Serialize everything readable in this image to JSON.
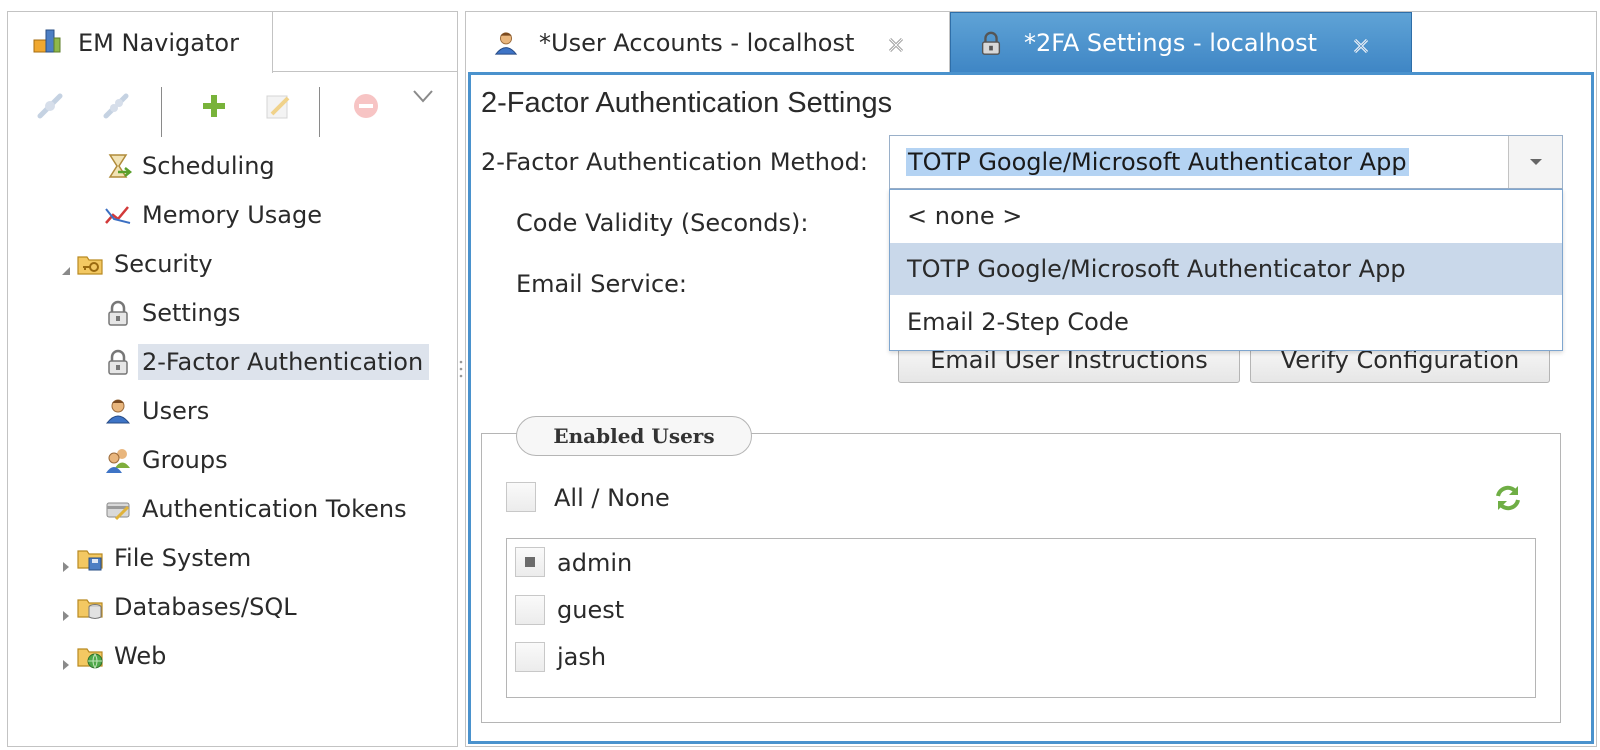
{
  "navigator": {
    "tab_label": "EM Navigator",
    "tree": [
      {
        "label": "Scheduling",
        "icon": "hourglass-icon"
      },
      {
        "label": "Memory Usage",
        "icon": "chart-line-icon"
      },
      {
        "label": "Security",
        "icon": "folder-key-icon",
        "expanded": true
      },
      {
        "label": "Settings",
        "icon": "lock-icon"
      },
      {
        "label": "2-Factor Authentication",
        "icon": "lock-icon",
        "selected": true
      },
      {
        "label": "Users",
        "icon": "user-icon"
      },
      {
        "label": "Groups",
        "icon": "group-icon"
      },
      {
        "label": "Authentication Tokens",
        "icon": "token-icon"
      },
      {
        "label": "File System",
        "icon": "folder-disk-icon",
        "expanded": false
      },
      {
        "label": "Databases/SQL",
        "icon": "folder-db-icon",
        "expanded": false
      },
      {
        "label": "Web",
        "icon": "folder-globe-icon",
        "expanded": false
      }
    ]
  },
  "editor": {
    "tabs": [
      {
        "label": "*User Accounts - localhost",
        "active": false
      },
      {
        "label": "*2FA Settings - localhost",
        "active": true
      }
    ],
    "title": "2-Factor Authentication Settings",
    "method_label": "2-Factor Authentication Method:",
    "method_value": "TOTP Google/Microsoft Authenticator App",
    "code_validity_label": "Code Validity (Seconds):",
    "email_service_label": "Email Service:",
    "dropdown_options": [
      "< none >",
      "TOTP Google/Microsoft Authenticator App",
      "Email 2-Step Code"
    ],
    "buttons": {
      "email_instructions": "Email User Instructions",
      "verify_config": "Verify Configuration"
    },
    "enabled_users": {
      "legend": "Enabled Users",
      "all_none_label": "All / None",
      "users": [
        {
          "name": "admin",
          "checked": "partial"
        },
        {
          "name": "guest",
          "checked": false
        },
        {
          "name": "jash",
          "checked": false
        }
      ]
    }
  },
  "colors": {
    "active_tab": "#4a92cd",
    "selection": "#dde3ec",
    "dropdown_highlight": "#c9d8ea",
    "value_highlight": "#b4d3f3"
  }
}
